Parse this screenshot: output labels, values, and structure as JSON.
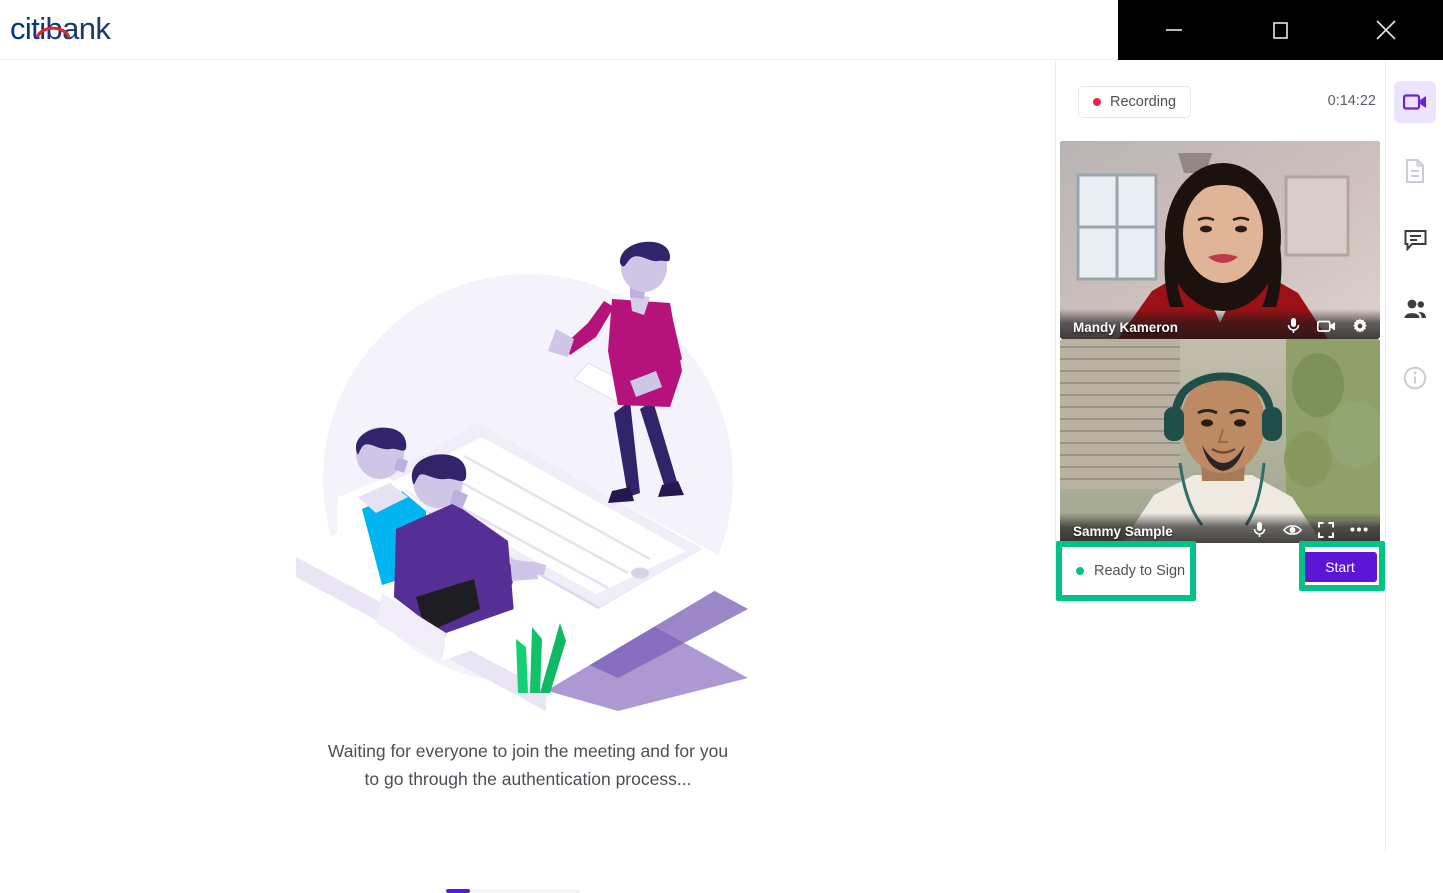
{
  "window": {
    "controls": [
      {
        "name": "minimize",
        "icon": "minimize-icon",
        "label": "Minimize"
      },
      {
        "name": "maximize",
        "icon": "maximize-icon",
        "label": "Maximize"
      },
      {
        "name": "close",
        "icon": "close-icon",
        "label": "Close"
      }
    ]
  },
  "header": {
    "brand_citi": "citi",
    "brand_bank": "bank",
    "brand_full": "citibank",
    "arc_color": "#e4262c",
    "text_color": "#053a7a"
  },
  "main": {
    "illustration_alt": "isometric-meeting-illustration",
    "waiting_line1": "Waiting for everyone to join the meeting and for you",
    "waiting_line2": "to go through the authentication process...",
    "progress_percent": 18,
    "progress_fill_color": "#5b16d6",
    "progress_track_color": "#f3f3f5"
  },
  "panel": {
    "recording": {
      "label": "Recording",
      "dot_color": "#e8283c"
    },
    "timer": "0:14:22",
    "tiles": [
      {
        "name": "Mandy Kameron",
        "icons": [
          {
            "icon": "microphone-icon",
            "label": "Mute microphone"
          },
          {
            "icon": "video-camera-icon",
            "label": "Toggle camera"
          },
          {
            "icon": "gear-icon",
            "label": "Settings"
          }
        ]
      },
      {
        "name": "Sammy Sample",
        "icons": [
          {
            "icon": "microphone-icon",
            "label": "Mute microphone"
          },
          {
            "icon": "eye-icon",
            "label": "View participant"
          },
          {
            "icon": "expand-icon",
            "label": "Expand video"
          },
          {
            "icon": "more-options-icon",
            "label": "More options"
          }
        ]
      }
    ],
    "status": {
      "label": "Ready to Sign",
      "dot_color": "#04c18a"
    },
    "start_button": {
      "label": "Start",
      "color": "#5b16d6"
    }
  },
  "rail": {
    "items": [
      {
        "icon": "video-camera-icon",
        "label": "Video",
        "active": true
      },
      {
        "icon": "document-icon",
        "label": "Documents",
        "active": false
      },
      {
        "icon": "chat-icon",
        "label": "Chat",
        "active": false
      },
      {
        "icon": "people-icon",
        "label": "Participants",
        "active": false
      },
      {
        "icon": "info-icon",
        "label": "Information",
        "active": false
      }
    ],
    "active_bg": "#ece4fc",
    "active_color": "#6b21d8"
  },
  "annotations": {
    "color": "#04c18a",
    "boxes": [
      {
        "target": "status-badge",
        "label": "Ready to Sign"
      },
      {
        "target": "start-button",
        "label": "Start"
      }
    ]
  }
}
